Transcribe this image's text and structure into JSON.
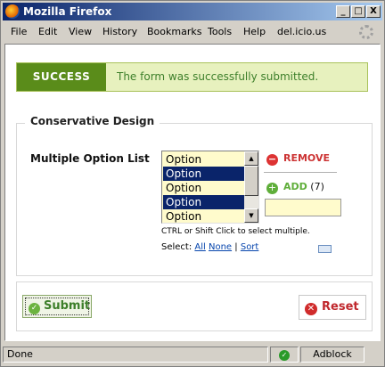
{
  "window": {
    "title": "Mozilla Firefox",
    "minimize": "_",
    "maximize": "□",
    "close": "X"
  },
  "menu": [
    "File",
    "Edit",
    "View",
    "History",
    "Bookmarks",
    "Tools",
    "Help",
    "del.icio.us"
  ],
  "success": {
    "tag": "SUCCESS",
    "message": "The form was successfully submitted."
  },
  "form": {
    "legend": "Conservative Design",
    "field_label": "Multiple Option List",
    "options": [
      {
        "label": "Option",
        "selected": false
      },
      {
        "label": "Option",
        "selected": true
      },
      {
        "label": "Option",
        "selected": false
      },
      {
        "label": "Option",
        "selected": true
      },
      {
        "label": "Option",
        "selected": false
      }
    ],
    "remove_label": "REMOVE",
    "add_label": "ADD",
    "add_count": "(7)",
    "add_value": "",
    "hint": "CTRL or Shift Click to select multiple.",
    "select_prefix": "Select:",
    "select_all": "All",
    "select_none": "None",
    "select_sep": "|",
    "select_sort": "Sort"
  },
  "buttons": {
    "submit": "Submit",
    "reset": "Reset"
  },
  "status": {
    "text": "Done",
    "adblock": "Adblock"
  },
  "colors": {
    "success_green": "#5a8c1a",
    "error_red": "#c0282d",
    "field_yellow": "#fffbcc"
  }
}
